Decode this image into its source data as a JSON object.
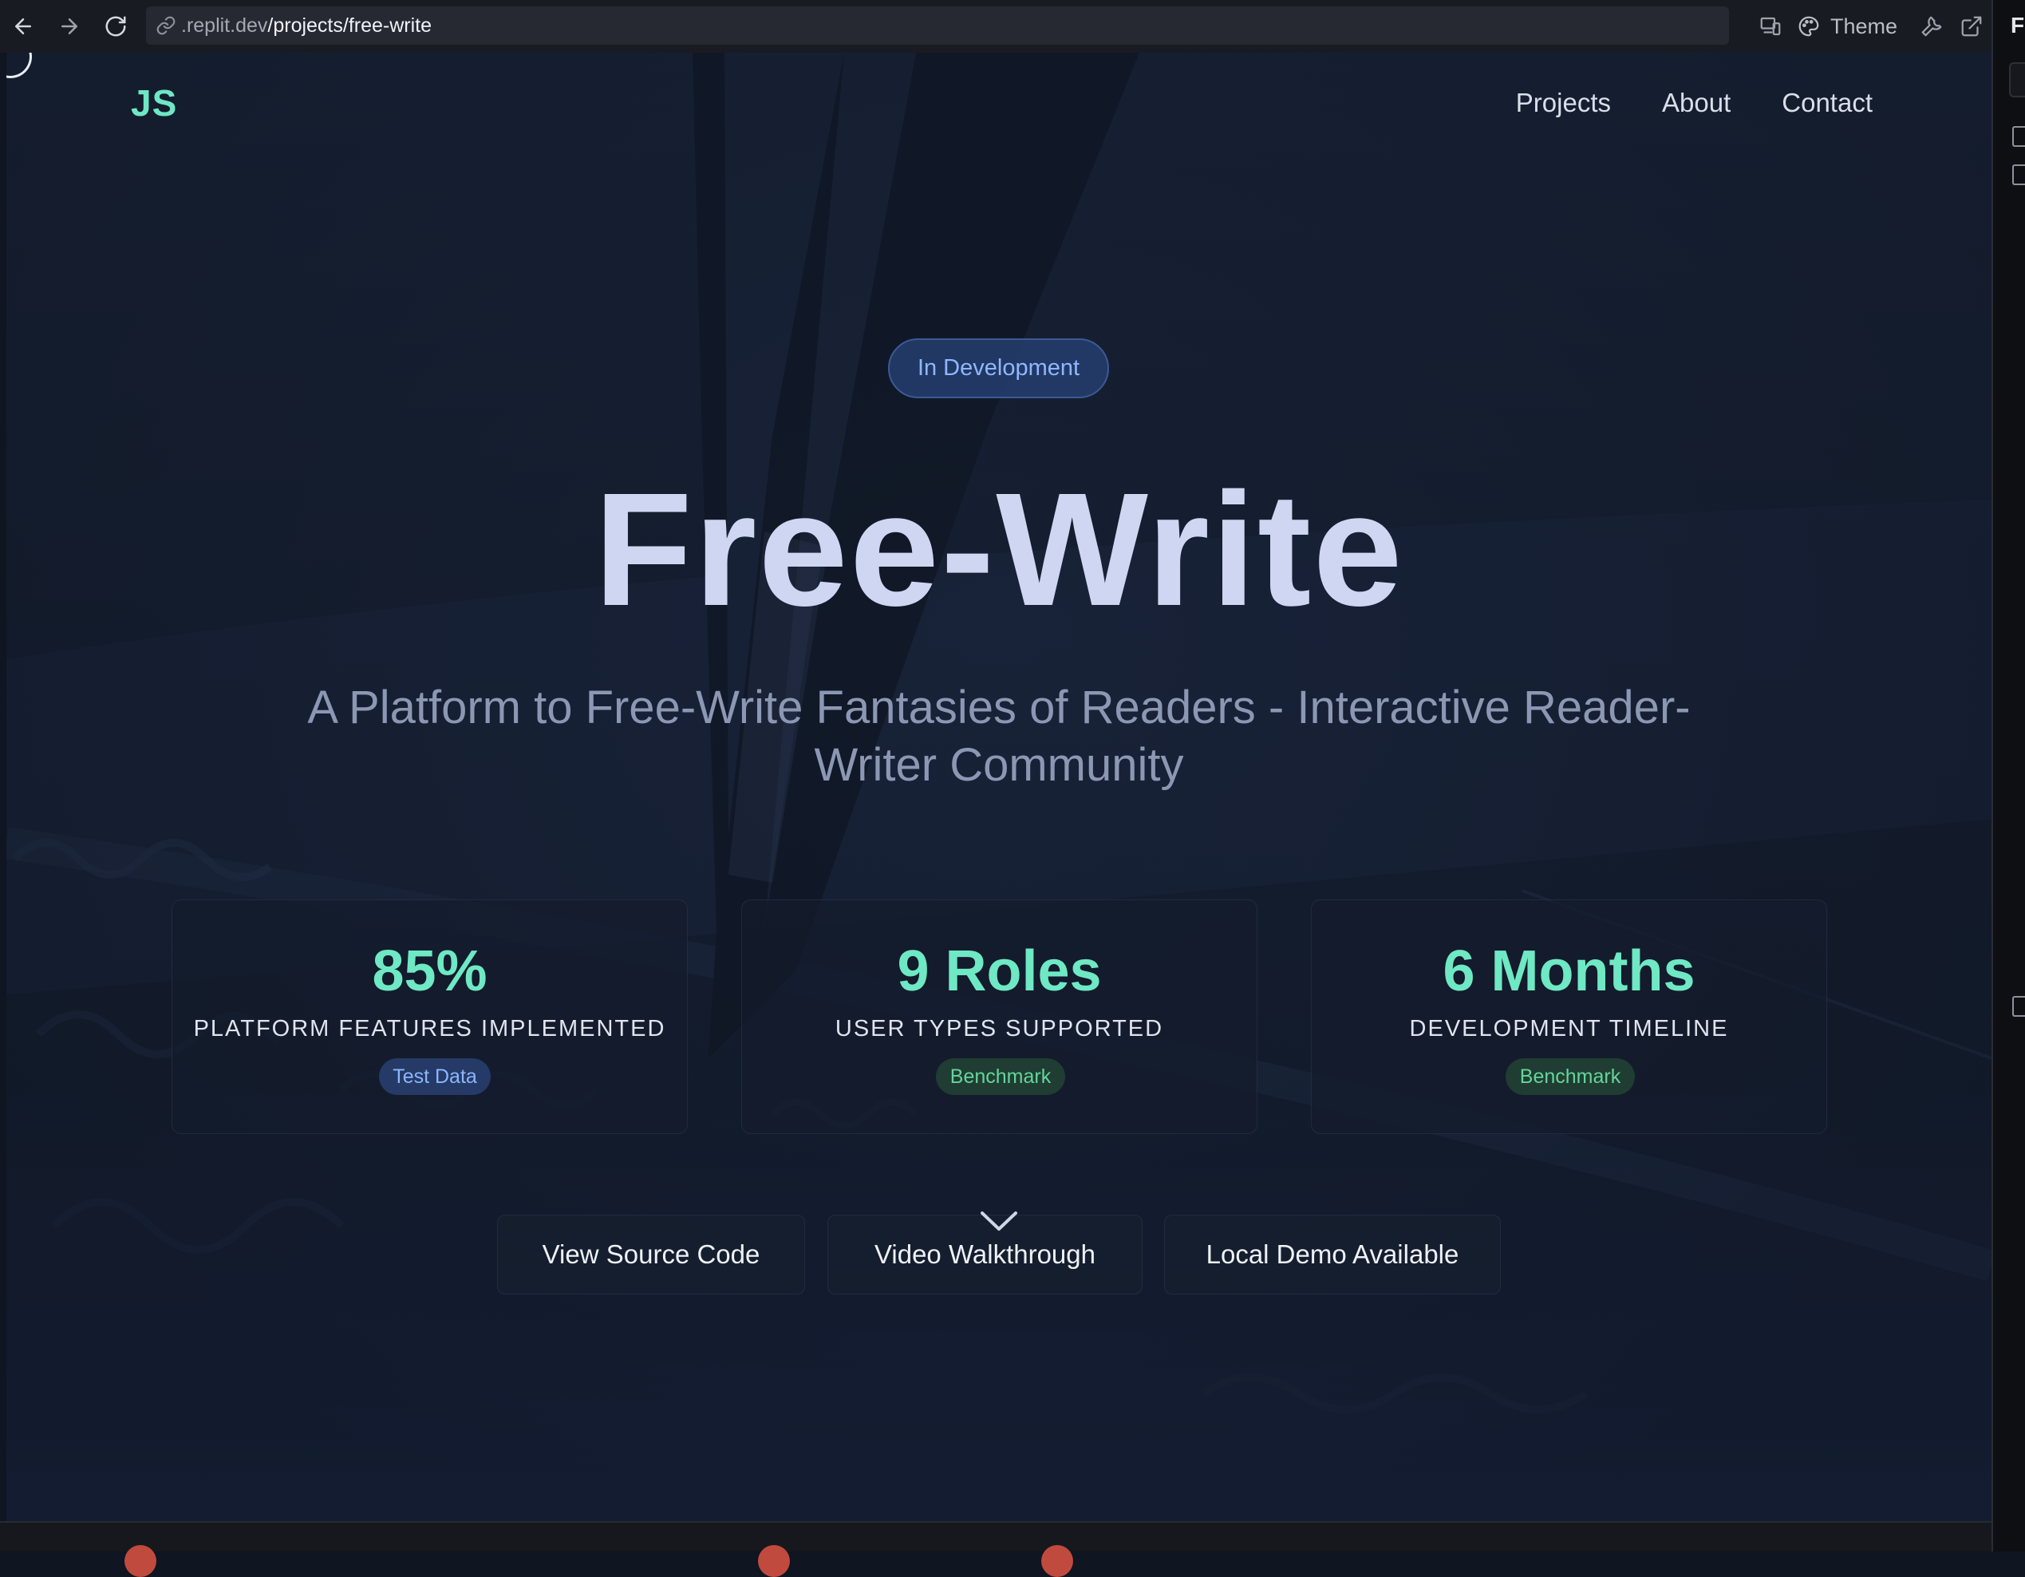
{
  "browser": {
    "url_domain": ".replit.dev",
    "url_path": "/projects/free-write",
    "theme_label": "Theme"
  },
  "side_panel": {
    "letter": "F"
  },
  "site": {
    "logo": "JS",
    "nav": [
      "Projects",
      "About",
      "Contact"
    ]
  },
  "hero": {
    "status": "In Development",
    "title": "Free-Write",
    "subtitle": "A Platform to Free-Write Fantasies of Readers - Interactive Reader-Writer Community"
  },
  "stats": [
    {
      "value": "85%",
      "label": "PLATFORM FEATURES IMPLEMENTED",
      "badge": "Test Data",
      "badge_color": "#8cb6ff"
    },
    {
      "value": "9 Roles",
      "label": "USER TYPES SUPPORTED",
      "badge": "Benchmark",
      "badge_color": "#66d49a"
    },
    {
      "value": "6 Months",
      "label": "DEVELOPMENT TIMELINE",
      "badge": "Benchmark",
      "badge_color": "#66d49a"
    }
  ],
  "actions": [
    "View Source Code",
    "Video Walkthrough",
    "Local Demo Available"
  ],
  "colors": {
    "accent": "#6ee7c5",
    "title": "#cfd6f2",
    "pill_text": "#8fb7ff"
  }
}
